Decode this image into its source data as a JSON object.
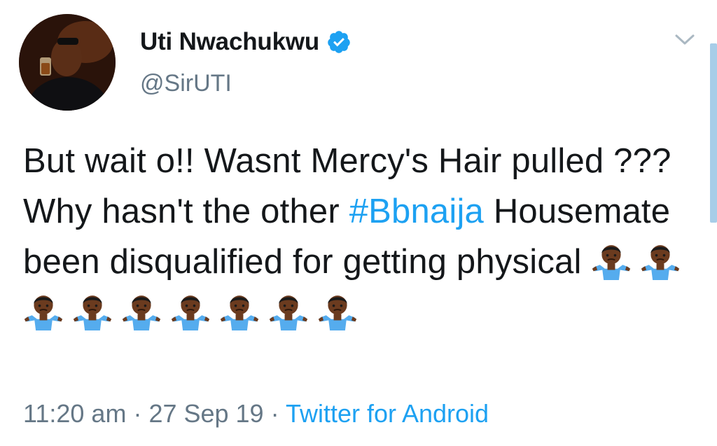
{
  "user": {
    "display_name": "Uti Nwachukwu",
    "handle": "@SirUTI",
    "verified": true
  },
  "tweet": {
    "text_part1": "But wait o!! Wasnt Mercy's Hair pulled ??? Why hasn't the other ",
    "hashtag": "#Bbnaija",
    "text_part2": " Housemate been disqualified for getting physical ",
    "emoji_name": "person-shrugging-emoji",
    "emoji_count": 9
  },
  "meta": {
    "time": "11:20 am",
    "separator1": " · ",
    "date": "27 Sep 19",
    "separator2": " · ",
    "source": "Twitter for Android"
  },
  "colors": {
    "link": "#1da1f2",
    "secondary_text": "#657786",
    "primary_text": "#14171a"
  },
  "icons": {
    "verified": "verified-badge-icon",
    "menu": "chevron-down-icon"
  }
}
